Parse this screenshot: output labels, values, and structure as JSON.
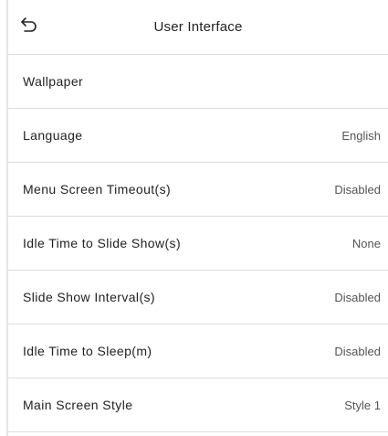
{
  "header": {
    "title": "User Interface",
    "back_icon": "back-arrow-icon"
  },
  "settings": [
    {
      "label": "Wallpaper",
      "value": ""
    },
    {
      "label": "Language",
      "value": "English"
    },
    {
      "label": "Menu Screen Timeout(s)",
      "value": "Disabled"
    },
    {
      "label": "Idle Time to Slide Show(s)",
      "value": "None"
    },
    {
      "label": "Slide Show Interval(s)",
      "value": "Disabled"
    },
    {
      "label": "Idle Time to Sleep(m)",
      "value": "Disabled"
    },
    {
      "label": "Main Screen Style",
      "value": "Style 1"
    }
  ]
}
